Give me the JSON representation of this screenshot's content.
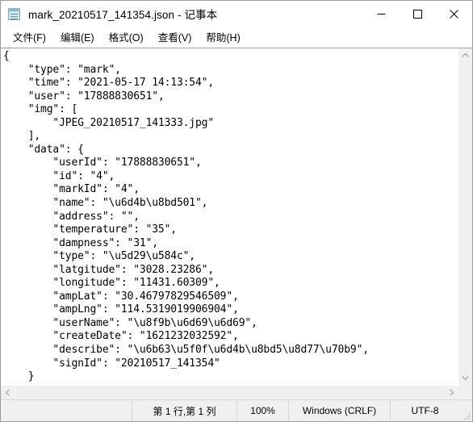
{
  "window": {
    "title": "mark_20210517_141354.json - 记事本",
    "icon": "notepad-icon",
    "controls": {
      "minimize": "最小化",
      "maximize": "最大化",
      "close": "关闭"
    }
  },
  "menubar": {
    "items": [
      {
        "label": "文件(F)",
        "name": "menu-file"
      },
      {
        "label": "编辑(E)",
        "name": "menu-edit"
      },
      {
        "label": "格式(O)",
        "name": "menu-format"
      },
      {
        "label": "查看(V)",
        "name": "menu-view"
      },
      {
        "label": "帮助(H)",
        "name": "menu-help"
      }
    ]
  },
  "editor": {
    "content": "{\n    \"type\": \"mark\",\n    \"time\": \"2021-05-17 14:13:54\",\n    \"user\": \"17888830651\",\n    \"img\": [\n        \"JPEG_20210517_141333.jpg\"\n    ],\n    \"data\": {\n        \"userId\": \"17888830651\",\n        \"id\": \"4\",\n        \"markId\": \"4\",\n        \"name\": \"\\u6d4b\\u8bd501\",\n        \"address\": \"\",\n        \"temperature\": \"35\",\n        \"dampness\": \"31\",\n        \"type\": \"\\u5d29\\u584c\",\n        \"latgitude\": \"3028.23286\",\n        \"longitude\": \"11431.60309\",\n        \"ampLat\": \"30.46797829546509\",\n        \"ampLng\": \"114.5319019906904\",\n        \"userName\": \"\\u8f9b\\u6d69\\u6d69\",\n        \"createDate\": \"1621232032592\",\n        \"describe\": \"\\u6b63\\u5f0f\\u6d4b\\u8bd5\\u8d77\\u70b9\",\n        \"signId\": \"20210517_141354\"\n    }\n}",
    "json_fields": {
      "type": "mark",
      "time": "2021-05-17 14:13:54",
      "user": "17888830651",
      "img": [
        "JPEG_20210517_141333.jpg"
      ],
      "data": {
        "userId": "17888830651",
        "id": "4",
        "markId": "4",
        "name": "\\u6d4b\\u8bd501",
        "address": "",
        "temperature": "35",
        "dampness": "31",
        "type": "\\u5d29\\u584c",
        "latgitude": "3028.23286",
        "longitude": "11431.60309",
        "ampLat": "30.46797829546509",
        "ampLng": "114.5319019906904",
        "userName": "\\u8f9b\\u6d69\\u6d69",
        "createDate": "1621232032592",
        "describe": "\\u6b63\\u5f0f\\u6d4b\\u8bd5\\u8d77\\u70b9",
        "signId": "20210517_141354"
      }
    }
  },
  "scrollbars": {
    "vertical_up": "▲",
    "vertical_down": "▼",
    "horizontal_left": "◄",
    "horizontal_right": "►"
  },
  "statusbar": {
    "position": "第 1 行,第 1 列",
    "zoom": "100%",
    "line_ending": "Windows (CRLF)",
    "encoding": "UTF-8"
  }
}
